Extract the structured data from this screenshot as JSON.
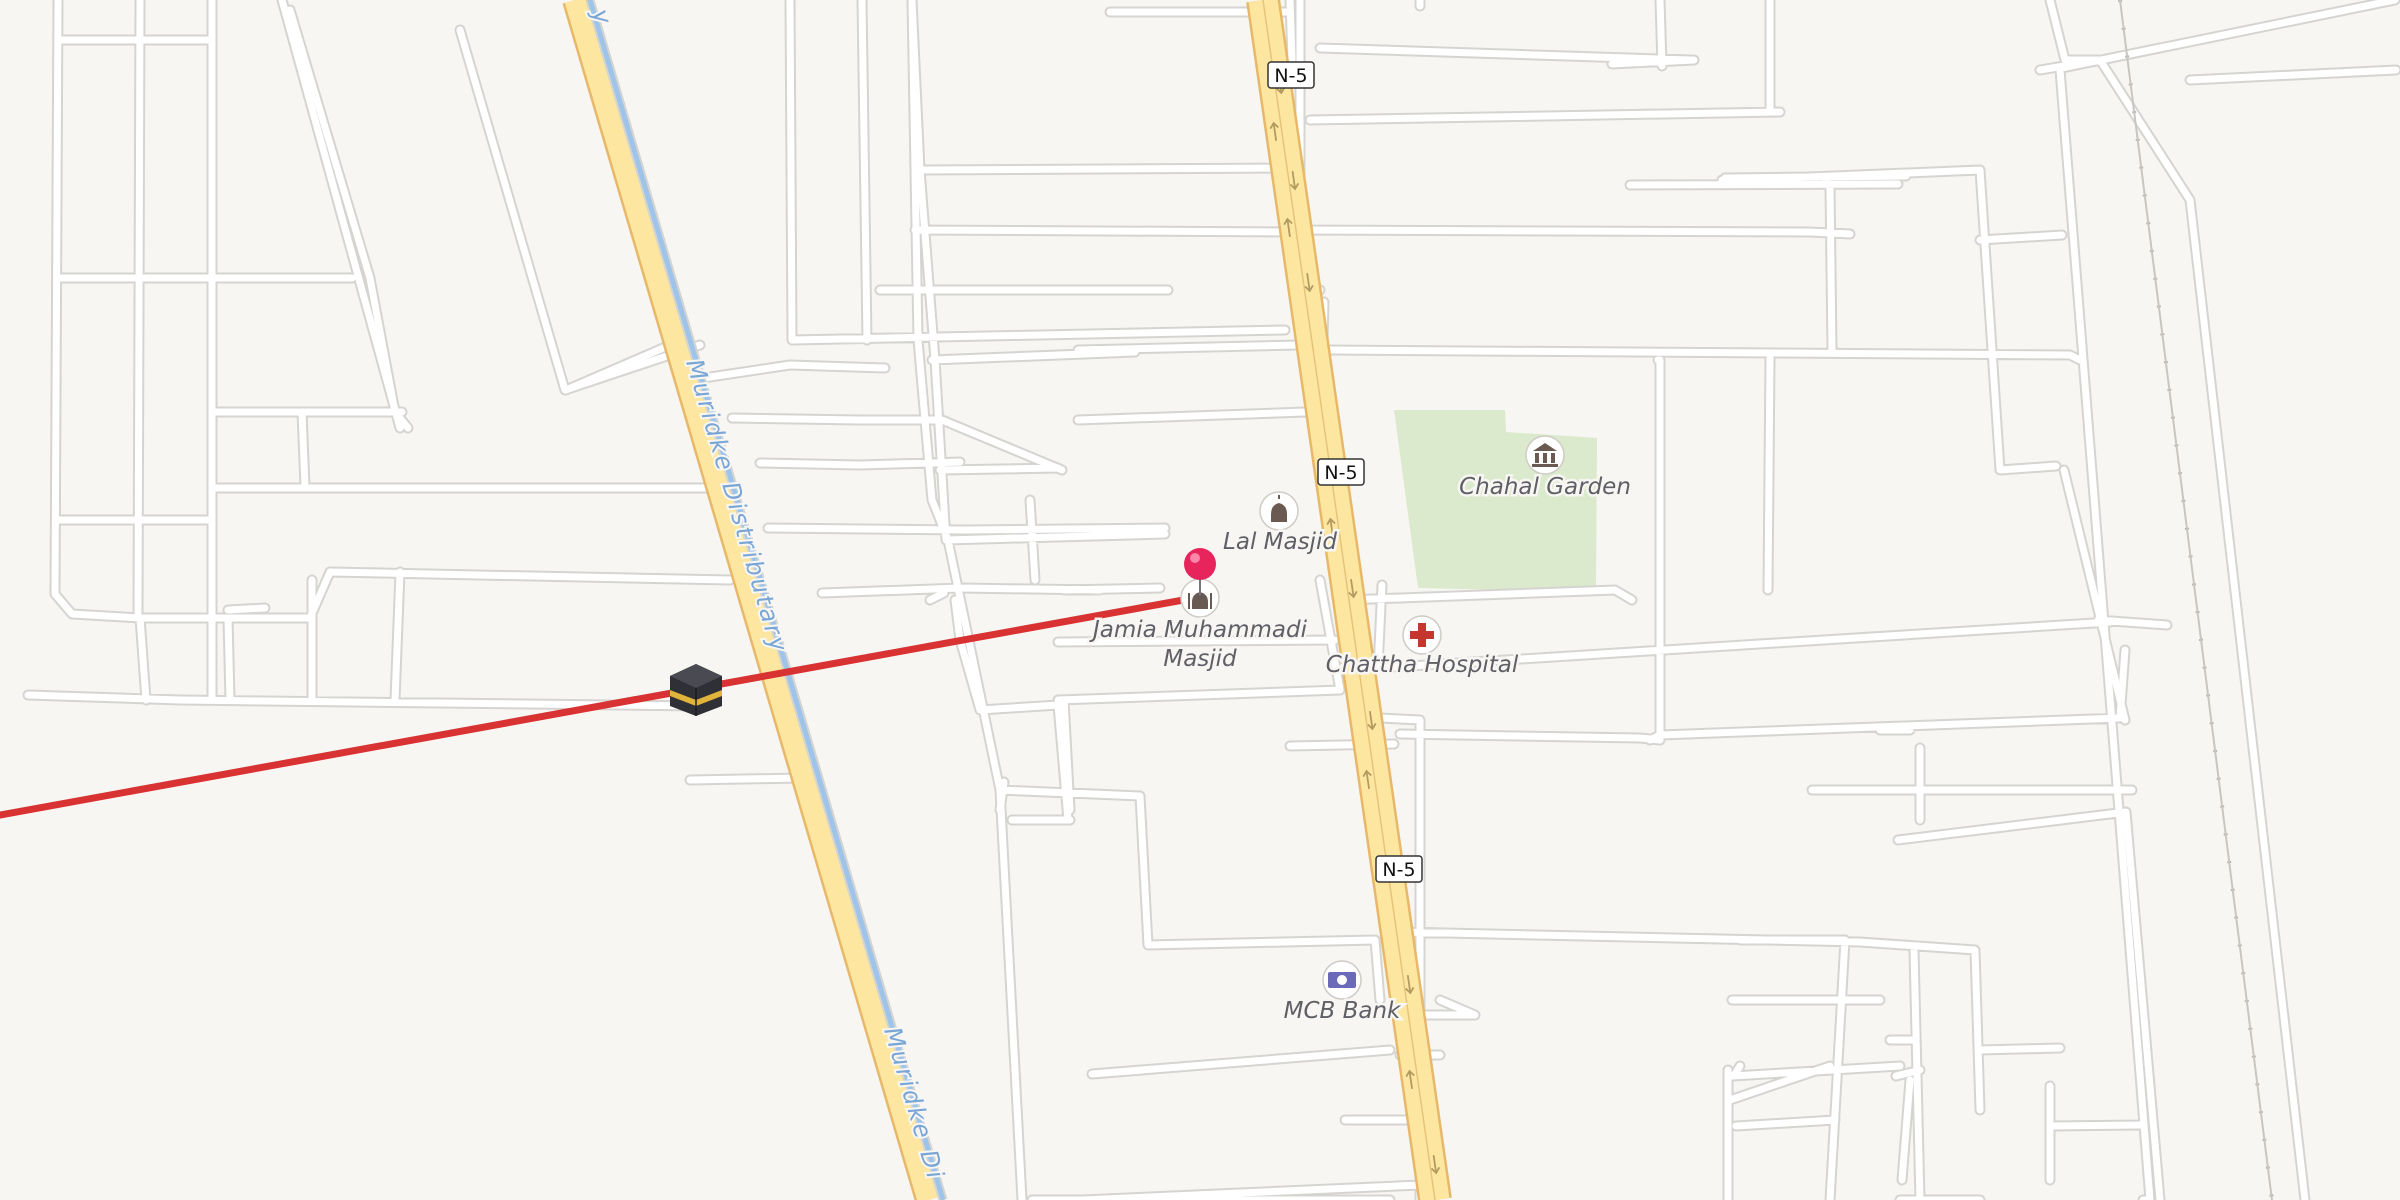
{
  "map": {
    "colors": {
      "background": "#f8f6f3",
      "minor_road": "#ffffff",
      "minor_road_casing": "#d6d4d0",
      "highway_fill": "#fde7a0",
      "highway_casing": "#e8b86a",
      "canal": "#9ec4ea",
      "park": "#dbe9cc",
      "route_line": "#d83232",
      "pin": "#e8245c"
    },
    "highway": {
      "name": "N-5",
      "shields": [
        "N-5",
        "N-5",
        "N-5"
      ]
    },
    "canal": {
      "labels": [
        "Muridke Distributary",
        "Muridke Di",
        "y"
      ]
    },
    "pois": [
      {
        "name": "Chahal Garden",
        "icon": "museum-icon"
      },
      {
        "name": "Lal Masjid",
        "icon": "mosque-icon"
      },
      {
        "name_lines": [
          "Jamia Muhammadi",
          "Masjid"
        ],
        "icon": "mosque-icon"
      },
      {
        "name": "Chattha Hospital",
        "icon": "hospital-icon"
      },
      {
        "name": "MCB Bank",
        "icon": "bank-icon"
      }
    ],
    "markers": {
      "destination": "pin-icon",
      "origin": "kaaba-icon"
    },
    "route": {
      "label": "qibla-direction-line"
    }
  }
}
